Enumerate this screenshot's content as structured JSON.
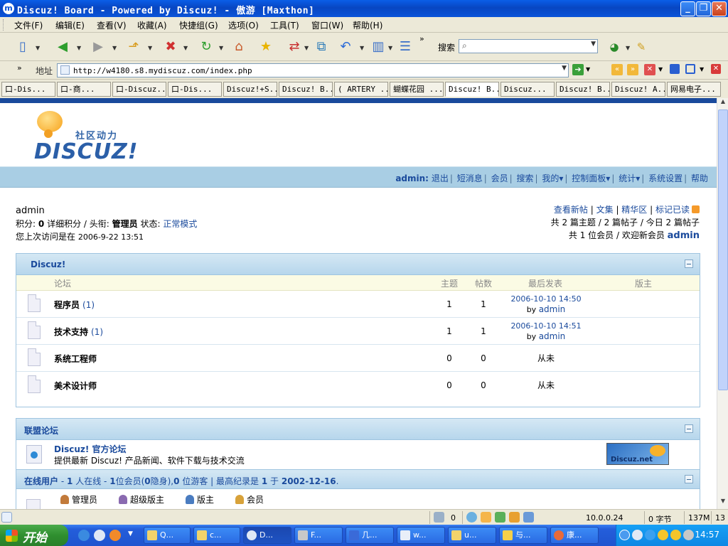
{
  "window": {
    "title": "Discuz! Board - Powered by Discuz! - 傲游 [Maxthon]",
    "app_icon": "m",
    "controls": {
      "minimize": "_",
      "maximize": "❐",
      "close": "✕"
    }
  },
  "menubar": {
    "items": [
      "文件(F)",
      "编辑(E)",
      "查看(V)",
      "收藏(A)",
      "快捷组(G)",
      "选项(O)",
      "工具(T)",
      "窗口(W)",
      "帮助(H)"
    ]
  },
  "toolbar": {
    "search_label": "搜索",
    "search_placeholder": "",
    "more": "»",
    "icons": [
      "new-page-icon",
      "back-icon",
      "forward-icon",
      "up-icon",
      "stop-icon",
      "refresh-icon",
      "home-icon",
      "favorites-icon",
      "translate-icon",
      "open-external-icon",
      "undo-close-icon",
      "columns-icon",
      "list-icon"
    ]
  },
  "addressbar": {
    "label": "地址",
    "url": "http://w4180.s8.mydiscuz.com/index.php",
    "more": "»"
  },
  "tabs": [
    "口-Dis...",
    "口-商...",
    "口-Discuz...",
    "口-Dis...",
    "Discuz!+S...",
    "Discuz! B...",
    "( ARTERY ...",
    "蝴蝶花园 ...",
    "Discuz! B...",
    "Discuz...",
    "Discuz! B...",
    "Discuz! A...",
    "网易电子..."
  ],
  "page": {
    "logo": {
      "slogan": "社区动力",
      "brand": "DISCUZ!"
    },
    "nav": {
      "user": "admin:",
      "links": [
        "退出",
        "短消息",
        "会员",
        "搜索",
        "我的▾",
        "控制面板▾",
        "统计▾",
        "系统设置",
        "帮助"
      ]
    },
    "userinfo": {
      "name": "admin",
      "points_label": "积分:",
      "points": "0",
      "detail_link": "详细积分",
      "title_label": "/ 头衔:",
      "title": "管理员",
      "status_label": "状态:",
      "status": "正常模式",
      "last_visit_label": "您上次访问是在",
      "last_visit": "2006-9-22 13:51"
    },
    "rightinfo": {
      "links": [
        "查看新帖",
        "文集",
        "精华区",
        "标记已读"
      ],
      "stats": "共 2 篇主题 / 2 篇帖子 / 今日 2 篇帖子",
      "members": "共 1 位会员 / 欢迎新会员",
      "newest_member": "admin"
    },
    "category": {
      "title": "Discuz!",
      "columns": {
        "forum": "论坛",
        "topics": "主题",
        "posts": "帖数",
        "last": "最后发表",
        "mods": "版主"
      },
      "forums": [
        {
          "name": "程序员",
          "count": "(1)",
          "topics": "1",
          "posts": "1",
          "last_date": "2006-10-10 14:50",
          "last_by": "by",
          "last_user": "admin"
        },
        {
          "name": "技术支持",
          "count": "(1)",
          "topics": "1",
          "posts": "1",
          "last_date": "2006-10-10 14:51",
          "last_by": "by",
          "last_user": "admin"
        },
        {
          "name": "系统工程师",
          "count": "",
          "topics": "0",
          "posts": "0",
          "never": "从未"
        },
        {
          "name": "美术设计师",
          "count": "",
          "topics": "0",
          "posts": "0",
          "never": "从未"
        }
      ]
    },
    "alliance": {
      "title": "联盟论坛",
      "name": "Discuz! 官方论坛",
      "desc": "提供最新 Discuz! 产品新闻、软件下载与技术交流",
      "banner_text": "Discuz.net"
    },
    "online": {
      "label": "在线用户",
      "dash1": "-",
      "online_count": "1",
      "online_text": "人在线",
      "dash2": "-",
      "member_count": "1",
      "member_text": "位会员(",
      "hidden_count": "0",
      "hidden_text": "隐身),",
      "guest_count": "0",
      "guest_text": "位游客 | 最高纪录是",
      "record_count": "1",
      "record_text": "于",
      "record_date": "2002-12-16",
      "end": ".",
      "legend": [
        "管理员",
        "超级版主",
        "版主",
        "会员"
      ]
    }
  },
  "statusbar": {
    "count1": "0",
    "ip": "10.0.0.24",
    "bytes": "0 字节",
    "mem": "137M",
    "extra": "13"
  },
  "taskbar": {
    "start": "开始",
    "tasks": [
      "Q...",
      "c...",
      "D...",
      "F...",
      "几...",
      "w...",
      "u...",
      "与...",
      "康..."
    ],
    "time": "14:57"
  }
}
